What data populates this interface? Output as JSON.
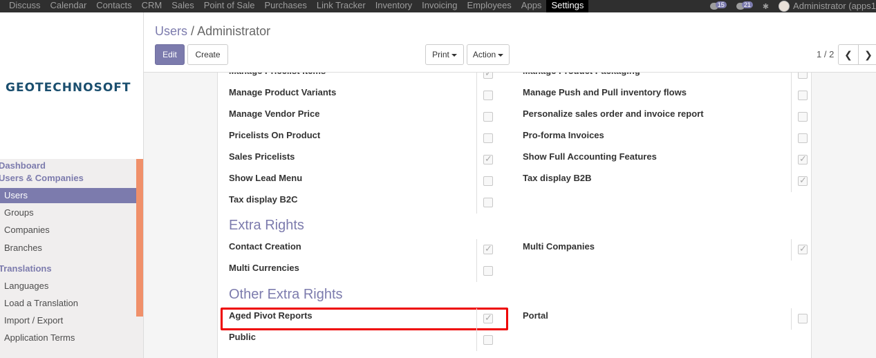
{
  "topbar": {
    "menu": [
      "Discuss",
      "Calendar",
      "Contacts",
      "CRM",
      "Sales",
      "Point of Sale",
      "Purchases",
      "Link Tracker",
      "Inventory",
      "Invoicing",
      "Employees",
      "Apps",
      "Settings"
    ],
    "active": "Settings",
    "chat_count": "15",
    "activity_count": "21",
    "user": "Administrator (apps1"
  },
  "sidebar": {
    "logo": "GEOTECHNOSOFT",
    "dashboard": "Dashboard",
    "users_companies": "Users & Companies",
    "users": "Users",
    "groups": "Groups",
    "companies": "Companies",
    "branches": "Branches",
    "translations": "Translations",
    "languages": "Languages",
    "load_translation": "Load a Translation",
    "import_export": "Import / Export",
    "app_terms": "Application Terms"
  },
  "breadcrumb": {
    "parent": "Users",
    "separator": "/",
    "current": "Administrator"
  },
  "buttons": {
    "edit": "Edit",
    "create": "Create",
    "print": "Print",
    "action": "Action"
  },
  "pager": {
    "value": "1 / 2"
  },
  "rights": {
    "left": [
      {
        "label": "Manage Pricelist Items",
        "checked": true
      },
      {
        "label": "Manage Product Variants",
        "checked": false
      },
      {
        "label": "Manage Vendor Price",
        "checked": false
      },
      {
        "label": "Pricelists On Product",
        "checked": false
      },
      {
        "label": "Sales Pricelists",
        "checked": true
      },
      {
        "label": "Show Lead Menu",
        "checked": false
      },
      {
        "label": "Tax display B2C",
        "checked": false
      }
    ],
    "right": [
      {
        "label": "Manage Product Packaging",
        "checked": false
      },
      {
        "label": "Manage Push and Pull inventory flows",
        "checked": false
      },
      {
        "label": "Personalize sales order and invoice report",
        "checked": false
      },
      {
        "label": "Pro-forma Invoices",
        "checked": false
      },
      {
        "label": "Show Full Accounting Features",
        "checked": true
      },
      {
        "label": "Tax display B2B",
        "checked": true
      }
    ]
  },
  "extra_rights": {
    "title": "Extra Rights",
    "left": [
      {
        "label": "Contact Creation",
        "checked": true
      },
      {
        "label": "Multi Currencies",
        "checked": false
      }
    ],
    "right": [
      {
        "label": "Multi Companies",
        "checked": true
      }
    ]
  },
  "other_extra_rights": {
    "title": "Other Extra Rights",
    "left": [
      {
        "label": "Aged Pivot Reports",
        "checked": true
      },
      {
        "label": "Public",
        "checked": false
      }
    ],
    "right": [
      {
        "label": "Portal",
        "checked": false
      }
    ]
  },
  "colors": {
    "accent": "#7c7bad",
    "navbar": "#2f2f2f",
    "highlight": "#e00000"
  }
}
